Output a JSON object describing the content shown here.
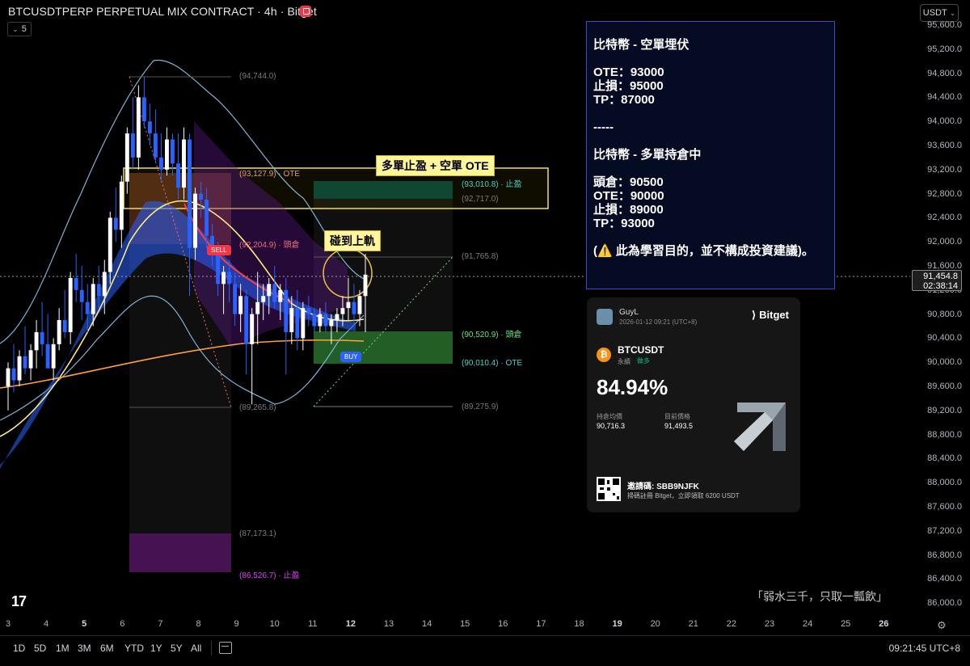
{
  "header": {
    "title": "BTCUSDTPERP PERPETUAL MIX CONTRACT · 4h · Bitget",
    "interval_multiplier": "5",
    "currency": "USDT"
  },
  "price_axis": {
    "ticks": [
      "95,600.0",
      "95,200.0",
      "94,800.0",
      "94,400.0",
      "94,000.0",
      "93,600.0",
      "93,200.0",
      "92,800.0",
      "92,400.0",
      "92,000.0",
      "91,600.0",
      "91,200.0",
      "90,800.0",
      "90,400.0",
      "90,000.0",
      "89,600.0",
      "89,200.0",
      "88,800.0",
      "88,400.0",
      "88,000.0",
      "87,600.0",
      "87,200.0",
      "86,800.0",
      "86,400.0",
      "86,000.0"
    ],
    "last_price": "91,454.8",
    "countdown": "02:38:14"
  },
  "time_axis": {
    "ticks": [
      "3",
      "4",
      "5",
      "6",
      "7",
      "8",
      "9",
      "10",
      "11",
      "12",
      "13",
      "14",
      "15",
      "16",
      "17",
      "18",
      "19",
      "20",
      "21",
      "22",
      "23",
      "24",
      "25",
      "26"
    ],
    "bold_ticks": [
      "5",
      "12",
      "19",
      "26"
    ]
  },
  "bottom_bar": {
    "ranges": [
      "1D",
      "5D",
      "1M",
      "3M",
      "6M",
      "YTD",
      "1Y",
      "5Y",
      "All"
    ],
    "clock": "09:21:45 UTC+8"
  },
  "chart_labels": {
    "high_left": "(94,744.0)",
    "ote_short": "(93,127.9) · OTE",
    "tp_long": "(93,010.8) · 止盈",
    "level_92717": "(92,717.0)",
    "entry_short": "(92,204.9) · 頭倉",
    "level_91765": "(91,765.8)",
    "entry_long": "(90,520.9) · 頭倉",
    "ote_long": "(90,010.4) · OTE",
    "low_right": "(89,275.9)",
    "low_left": "(89,265.8)",
    "level_87173": "(87,173.1)",
    "tp_short": "(86,526.7) · 止盈",
    "sell_tag": "SELL",
    "buy_tag": "BUY"
  },
  "callouts": {
    "top": "多單止盈 + 空單 OTE",
    "touch": "碰到上軌"
  },
  "note": {
    "lines": [
      "比特幣 - 空單埋伏",
      "",
      "OTE：93000",
      "止損：95000",
      "TP：87000",
      "",
      "-----",
      "",
      "比特幣 - 多單持倉中",
      "",
      "頭倉：90500",
      "OTE：90000",
      "止損：89000",
      "TP：93000",
      "",
      "(⚠️ 此為學習目的，並不構成投資建議)。"
    ]
  },
  "share_card": {
    "user": "GuyL",
    "datetime": "2026-01-12 09:21  (UTC+8)",
    "brand": "Bitget",
    "pair": "BTCUSDT",
    "kind": "永續",
    "side": "做多",
    "roi": "84.94%",
    "avg_label": "持倉均價",
    "avg_value": "90,716.3",
    "cur_label": "目前價格",
    "cur_value": "91,493.5",
    "invite": "邀請碼: SBB9NJFK",
    "promo": "掃碼註冊 Bitget，立即領取 6200 USDT"
  },
  "watermark": "「弱水三千，只取一瓢飲」",
  "chart_data": {
    "type": "candlestick",
    "timeframe": "4h",
    "ylim": [
      86000,
      95800
    ],
    "last_price": 91454.8,
    "levels": [
      94744.0,
      93127.9,
      93010.8,
      92717.0,
      92204.9,
      91765.8,
      90520.9,
      90010.4,
      89275.9,
      89265.8,
      87173.1,
      86526.7
    ],
    "candles": [
      {
        "o": 89600,
        "h": 90000,
        "l": 89200,
        "c": 89900
      },
      {
        "o": 89900,
        "h": 90300,
        "l": 89500,
        "c": 89700
      },
      {
        "o": 89700,
        "h": 90200,
        "l": 89600,
        "c": 90100
      },
      {
        "o": 90100,
        "h": 90600,
        "l": 89800,
        "c": 89900
      },
      {
        "o": 89900,
        "h": 90300,
        "l": 89700,
        "c": 90200
      },
      {
        "o": 90200,
        "h": 90700,
        "l": 89900,
        "c": 90500
      },
      {
        "o": 90500,
        "h": 91000,
        "l": 90100,
        "c": 90300
      },
      {
        "o": 90300,
        "h": 90800,
        "l": 89900,
        "c": 89900
      },
      {
        "o": 89900,
        "h": 90400,
        "l": 89700,
        "c": 90300
      },
      {
        "o": 90300,
        "h": 90900,
        "l": 90200,
        "c": 90700
      },
      {
        "o": 90700,
        "h": 91200,
        "l": 90400,
        "c": 90500
      },
      {
        "o": 90500,
        "h": 91500,
        "l": 90300,
        "c": 91400
      },
      {
        "o": 91400,
        "h": 91800,
        "l": 91000,
        "c": 91200
      },
      {
        "o": 91200,
        "h": 91600,
        "l": 90700,
        "c": 91000
      },
      {
        "o": 91000,
        "h": 91300,
        "l": 90500,
        "c": 90800
      },
      {
        "o": 90800,
        "h": 91400,
        "l": 90600,
        "c": 91300
      },
      {
        "o": 91300,
        "h": 91600,
        "l": 90900,
        "c": 91100
      },
      {
        "o": 91100,
        "h": 91700,
        "l": 90800,
        "c": 91500
      },
      {
        "o": 91500,
        "h": 92500,
        "l": 91300,
        "c": 92400
      },
      {
        "o": 92400,
        "h": 92900,
        "l": 92000,
        "c": 92200
      },
      {
        "o": 92200,
        "h": 93100,
        "l": 91900,
        "c": 93000
      },
      {
        "o": 93000,
        "h": 93900,
        "l": 92800,
        "c": 93800
      },
      {
        "o": 93800,
        "h": 94400,
        "l": 93200,
        "c": 93400
      },
      {
        "o": 93400,
        "h": 94600,
        "l": 93200,
        "c": 94400
      },
      {
        "o": 94400,
        "h": 94744,
        "l": 93900,
        "c": 94000
      },
      {
        "o": 94000,
        "h": 94300,
        "l": 93600,
        "c": 93800
      },
      {
        "o": 93800,
        "h": 94200,
        "l": 93300,
        "c": 93400
      },
      {
        "o": 93400,
        "h": 93800,
        "l": 93000,
        "c": 93200
      },
      {
        "o": 93200,
        "h": 93900,
        "l": 93100,
        "c": 93700
      },
      {
        "o": 93700,
        "h": 93800,
        "l": 93100,
        "c": 93300
      },
      {
        "o": 93300,
        "h": 93800,
        "l": 92700,
        "c": 92900
      },
      {
        "o": 92900,
        "h": 93900,
        "l": 92700,
        "c": 93700
      },
      {
        "o": 93700,
        "h": 93800,
        "l": 91100,
        "c": 91900
      },
      {
        "o": 91900,
        "h": 92900,
        "l": 91700,
        "c": 92800
      },
      {
        "o": 92800,
        "h": 93000,
        "l": 92400,
        "c": 92700
      },
      {
        "o": 92700,
        "h": 92900,
        "l": 91900,
        "c": 92100
      },
      {
        "o": 92100,
        "h": 92300,
        "l": 91600,
        "c": 91800
      },
      {
        "o": 91800,
        "h": 92000,
        "l": 91100,
        "c": 91300
      },
      {
        "o": 91300,
        "h": 91600,
        "l": 90800,
        "c": 91500
      },
      {
        "o": 91500,
        "h": 91700,
        "l": 91000,
        "c": 91300
      },
      {
        "o": 91300,
        "h": 91500,
        "l": 90600,
        "c": 90800
      },
      {
        "o": 90800,
        "h": 91300,
        "l": 90500,
        "c": 91100
      },
      {
        "o": 91100,
        "h": 91200,
        "l": 89800,
        "c": 90300
      },
      {
        "o": 90300,
        "h": 90900,
        "l": 89300,
        "c": 90800
      },
      {
        "o": 90800,
        "h": 91500,
        "l": 90300,
        "c": 91000
      },
      {
        "o": 91000,
        "h": 91300,
        "l": 90700,
        "c": 91100
      },
      {
        "o": 91100,
        "h": 91400,
        "l": 90800,
        "c": 91300
      },
      {
        "o": 91300,
        "h": 91600,
        "l": 90900,
        "c": 91000
      },
      {
        "o": 91000,
        "h": 91300,
        "l": 90700,
        "c": 91200
      },
      {
        "o": 91200,
        "h": 91400,
        "l": 89800,
        "c": 90500
      },
      {
        "o": 90500,
        "h": 91100,
        "l": 90300,
        "c": 90900
      },
      {
        "o": 90900,
        "h": 91200,
        "l": 90200,
        "c": 90400
      },
      {
        "o": 90400,
        "h": 91000,
        "l": 90200,
        "c": 90900
      },
      {
        "o": 90900,
        "h": 91100,
        "l": 90600,
        "c": 90800
      },
      {
        "o": 90800,
        "h": 90900,
        "l": 90500,
        "c": 90600
      },
      {
        "o": 90600,
        "h": 90900,
        "l": 90500,
        "c": 90800
      },
      {
        "o": 90800,
        "h": 91000,
        "l": 90500,
        "c": 90600
      },
      {
        "o": 90600,
        "h": 90800,
        "l": 90300,
        "c": 90700
      },
      {
        "o": 90700,
        "h": 90900,
        "l": 90500,
        "c": 90800
      },
      {
        "o": 90800,
        "h": 91100,
        "l": 90600,
        "c": 90900
      },
      {
        "o": 90900,
        "h": 91400,
        "l": 90700,
        "c": 91000
      },
      {
        "o": 91000,
        "h": 91300,
        "l": 90600,
        "c": 90800
      },
      {
        "o": 90800,
        "h": 91200,
        "l": 90600,
        "c": 91100
      },
      {
        "o": 91100,
        "h": 91800,
        "l": 90500,
        "c": 91455
      }
    ],
    "colors": {
      "up": "#ffffff",
      "down": "#2962ff"
    }
  }
}
